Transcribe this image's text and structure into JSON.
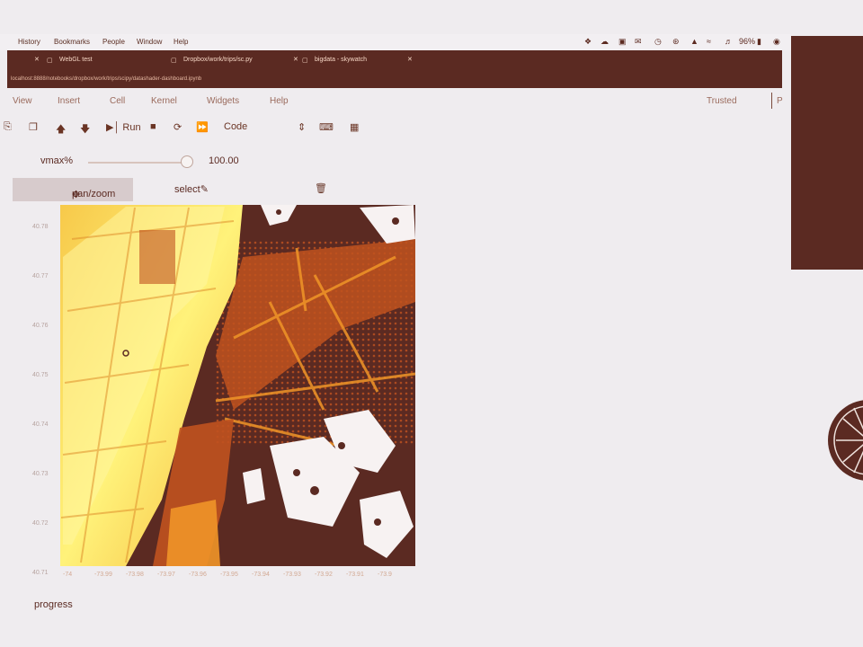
{
  "menubar": {
    "items": [
      "History",
      "Bookmarks",
      "People",
      "Window",
      "Help"
    ],
    "battery": "96%"
  },
  "tabs": [
    {
      "label": "WebGL test"
    },
    {
      "label": "Dropbox/work/trips/sc.py"
    },
    {
      "label": "bigdata - skywatch"
    }
  ],
  "address": "localhost:8888/notebooks/dropbox/work/trips/scipy/datashader-dashboard.ipynb",
  "notebook": {
    "menus": [
      "View",
      "Insert",
      "Cell",
      "Kernel",
      "Widgets",
      "Help"
    ],
    "trusted": "Trusted",
    "kernel_letter": "P"
  },
  "toolbar": {
    "run_label": "Run",
    "cell_type": "Code",
    "icons": [
      "save-icon",
      "copy-icon",
      "move-up-icon",
      "move-down-icon",
      "run-icon",
      "stop-icon",
      "restart-icon",
      "fast-forward-icon",
      "cell-type-chevron-icon",
      "keyboard-icon",
      "bar-chart-icon"
    ]
  },
  "widget": {
    "slider_label": "vmax%",
    "slider_value": "100.00",
    "slider_fraction": 1.0
  },
  "plot_tools": {
    "pan_label": "pan/zoom",
    "select_label": "select"
  },
  "plot": {
    "y_ticks": [
      "40.78",
      "40.77",
      "40.76",
      "40.75",
      "40.74",
      "40.73",
      "40.72",
      "40.71"
    ],
    "x_ticks": [
      "-74",
      "-73.99",
      "-73.98",
      "-73.97",
      "-73.96",
      "-73.95",
      "-73.94",
      "-73.93",
      "-73.92",
      "-73.91",
      "-73.9"
    ],
    "colors": {
      "background": "#5b2a22",
      "low": "#c0521f",
      "mid": "#f09528",
      "high": "#fff27a"
    }
  },
  "progress_label": "progress"
}
